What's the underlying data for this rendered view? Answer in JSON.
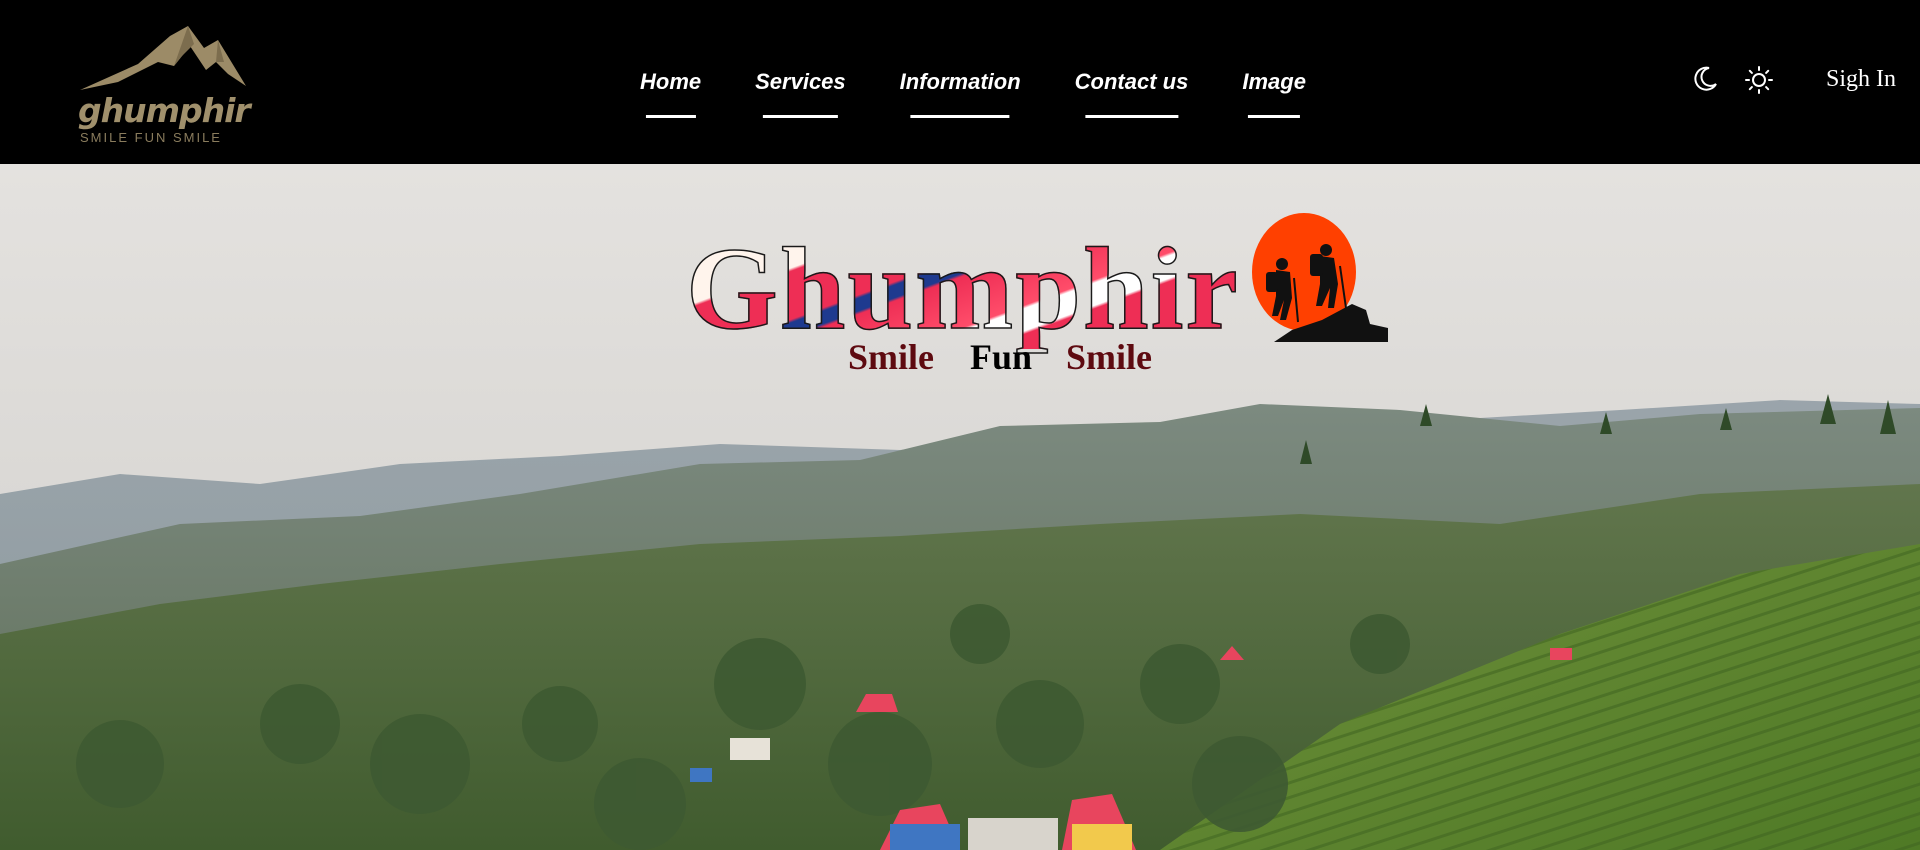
{
  "header": {
    "logo": {
      "wordmark": "ghumphir",
      "tagline": "SMILE FUN SMILE"
    },
    "nav": [
      {
        "label": "Home"
      },
      {
        "label": "Services"
      },
      {
        "label": "Information"
      },
      {
        "label": "Contact us"
      },
      {
        "label": "Image"
      }
    ],
    "theme_toggles": {
      "dark_icon": "moon-icon",
      "light_icon": "sun-icon"
    },
    "signin_label": "Sigh In"
  },
  "hero": {
    "title": "Ghumphir",
    "tagline": [
      "Smile",
      "Fun",
      "Smile"
    ],
    "icon": "hikers-sunset-icon"
  },
  "colors": {
    "header_bg": "#000000",
    "logo_gold": "#a0906c",
    "title_red": "#ee2e55",
    "title_blue": "#1e3a8f",
    "tagline_maroon": "#5e0a10",
    "sun_orange": "#ff4000"
  }
}
